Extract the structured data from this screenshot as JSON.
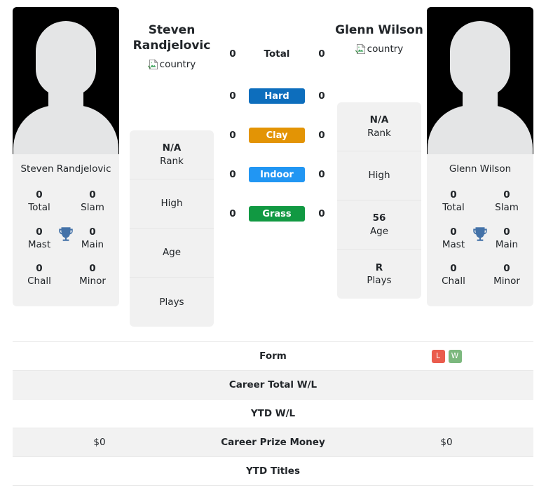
{
  "players": {
    "left": {
      "name": "Steven Randjelovic",
      "card_name": "Steven Randjelovic",
      "country_alt": "country",
      "stats": [
        {
          "num": "0",
          "label": "Total"
        },
        {
          "num": "0",
          "label": "Slam"
        },
        {
          "num": "0",
          "label": "Mast"
        },
        {
          "num": "0",
          "label": "Main"
        },
        {
          "num": "0",
          "label": "Chall"
        },
        {
          "num": "0",
          "label": "Minor"
        }
      ],
      "info": [
        {
          "value": "N/A",
          "label": "Rank"
        },
        {
          "value": "",
          "label": "High"
        },
        {
          "value": "",
          "label": "Age"
        },
        {
          "value": "",
          "label": "Plays"
        }
      ]
    },
    "right": {
      "name": "Glenn Wilson",
      "card_name": "Glenn Wilson",
      "country_alt": "country",
      "stats": [
        {
          "num": "0",
          "label": "Total"
        },
        {
          "num": "0",
          "label": "Slam"
        },
        {
          "num": "0",
          "label": "Mast"
        },
        {
          "num": "0",
          "label": "Main"
        },
        {
          "num": "0",
          "label": "Chall"
        },
        {
          "num": "0",
          "label": "Minor"
        }
      ],
      "info": [
        {
          "value": "N/A",
          "label": "Rank"
        },
        {
          "value": "",
          "label": "High"
        },
        {
          "value": "56",
          "label": "Age"
        },
        {
          "value": "R",
          "label": "Plays"
        }
      ]
    }
  },
  "surfaces": [
    {
      "label": "Total",
      "left": "0",
      "right": "0",
      "color": null,
      "badge": false
    },
    {
      "label": "Hard",
      "left": "0",
      "right": "0",
      "color": "#0d6ebd",
      "badge": true
    },
    {
      "label": "Clay",
      "left": "0",
      "right": "0",
      "color": "#e39405",
      "badge": true
    },
    {
      "label": "Indoor",
      "left": "0",
      "right": "0",
      "color": "#2196f3",
      "badge": true
    },
    {
      "label": "Grass",
      "left": "0",
      "right": "0",
      "color": "#119942",
      "badge": true
    }
  ],
  "table_rows": [
    {
      "label": "Form",
      "left": "",
      "right": "",
      "striped": false,
      "form": [
        "L",
        "W"
      ]
    },
    {
      "label": "Career Total W/L",
      "left": "",
      "right": "",
      "striped": true,
      "form": null
    },
    {
      "label": "YTD W/L",
      "left": "",
      "right": "",
      "striped": false,
      "form": null
    },
    {
      "label": "Career Prize Money",
      "left": "$0",
      "right": "$0",
      "striped": true,
      "form": null
    },
    {
      "label": "YTD Titles",
      "left": "",
      "right": "",
      "striped": false,
      "form": null
    }
  ],
  "colors": {
    "form_loss": "#ea5c4d",
    "form_win": "#7cb87e",
    "trophy": "#4472a8",
    "card_bg": "#f1f1f1",
    "stripe": "#f2f2f2"
  }
}
